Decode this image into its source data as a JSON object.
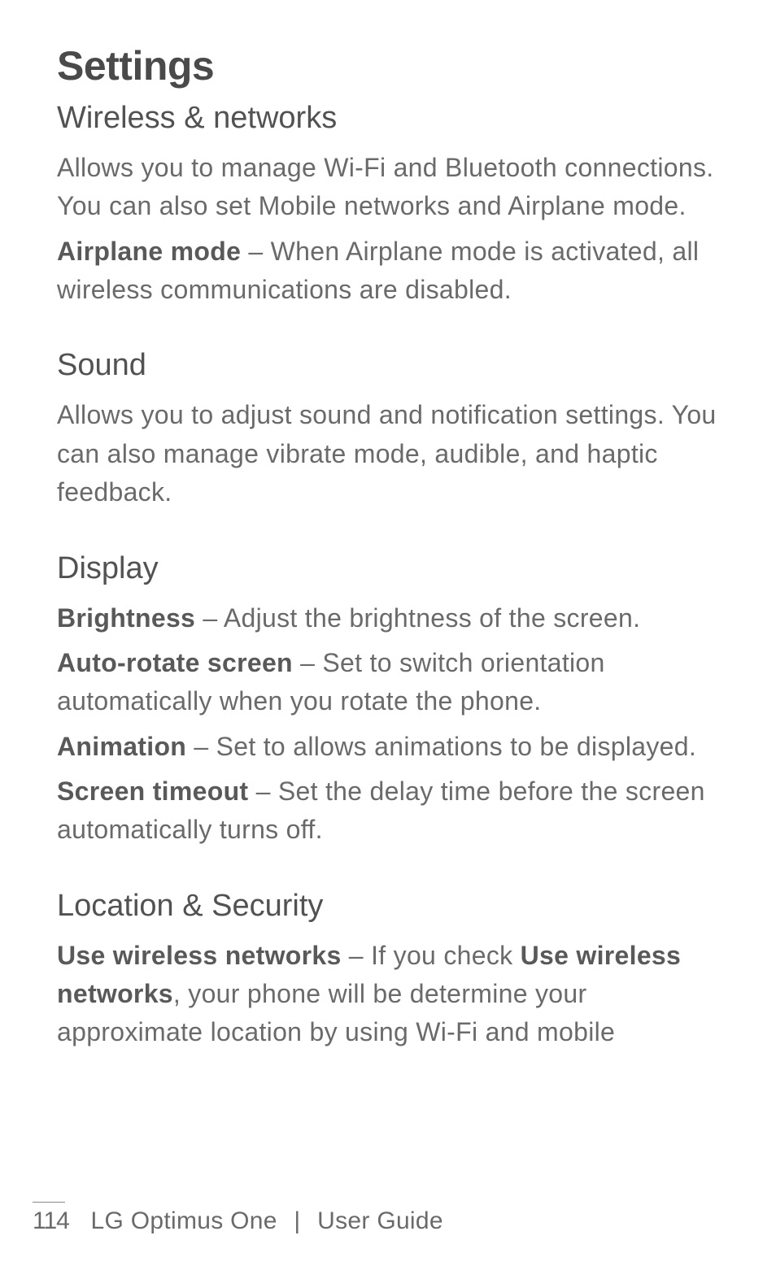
{
  "page": {
    "title": "Settings"
  },
  "sections": {
    "wireless": {
      "heading": "Wireless & networks",
      "intro": "Allows you to manage Wi-Fi and Bluetooth connections. You can also set Mobile networks and Airplane mode.",
      "airplane_label": "Airplane mode",
      "airplane_desc": " – When Airplane mode is activated, all wireless communications are disabled."
    },
    "sound": {
      "heading": "Sound",
      "intro": "Allows you to adjust sound and notification settings. You can also manage vibrate mode, audible, and haptic feedback."
    },
    "display": {
      "heading": "Display",
      "brightness_label": "Brightness",
      "brightness_desc": " – Adjust the brightness of the screen.",
      "autorotate_label": "Auto-rotate screen",
      "autorotate_desc": " – Set to switch orientation automatically when you rotate the phone.",
      "animation_label": "Animation",
      "animation_desc": " – Set to allows animations to be displayed.",
      "timeout_label": "Screen timeout",
      "timeout_desc": " – Set the delay time before the screen automatically turns off."
    },
    "location": {
      "heading": "Location & Security",
      "uwn_label": "Use wireless networks",
      "uwn_mid1": " – If you check ",
      "uwn_label2": "Use wireless networks",
      "uwn_mid2": ", your phone will be determine your approximate location by using Wi-Fi and mobile"
    }
  },
  "footer": {
    "page_number": "114",
    "product": "LG Optimus One",
    "separator": "|",
    "doc_type": "User Guide"
  }
}
